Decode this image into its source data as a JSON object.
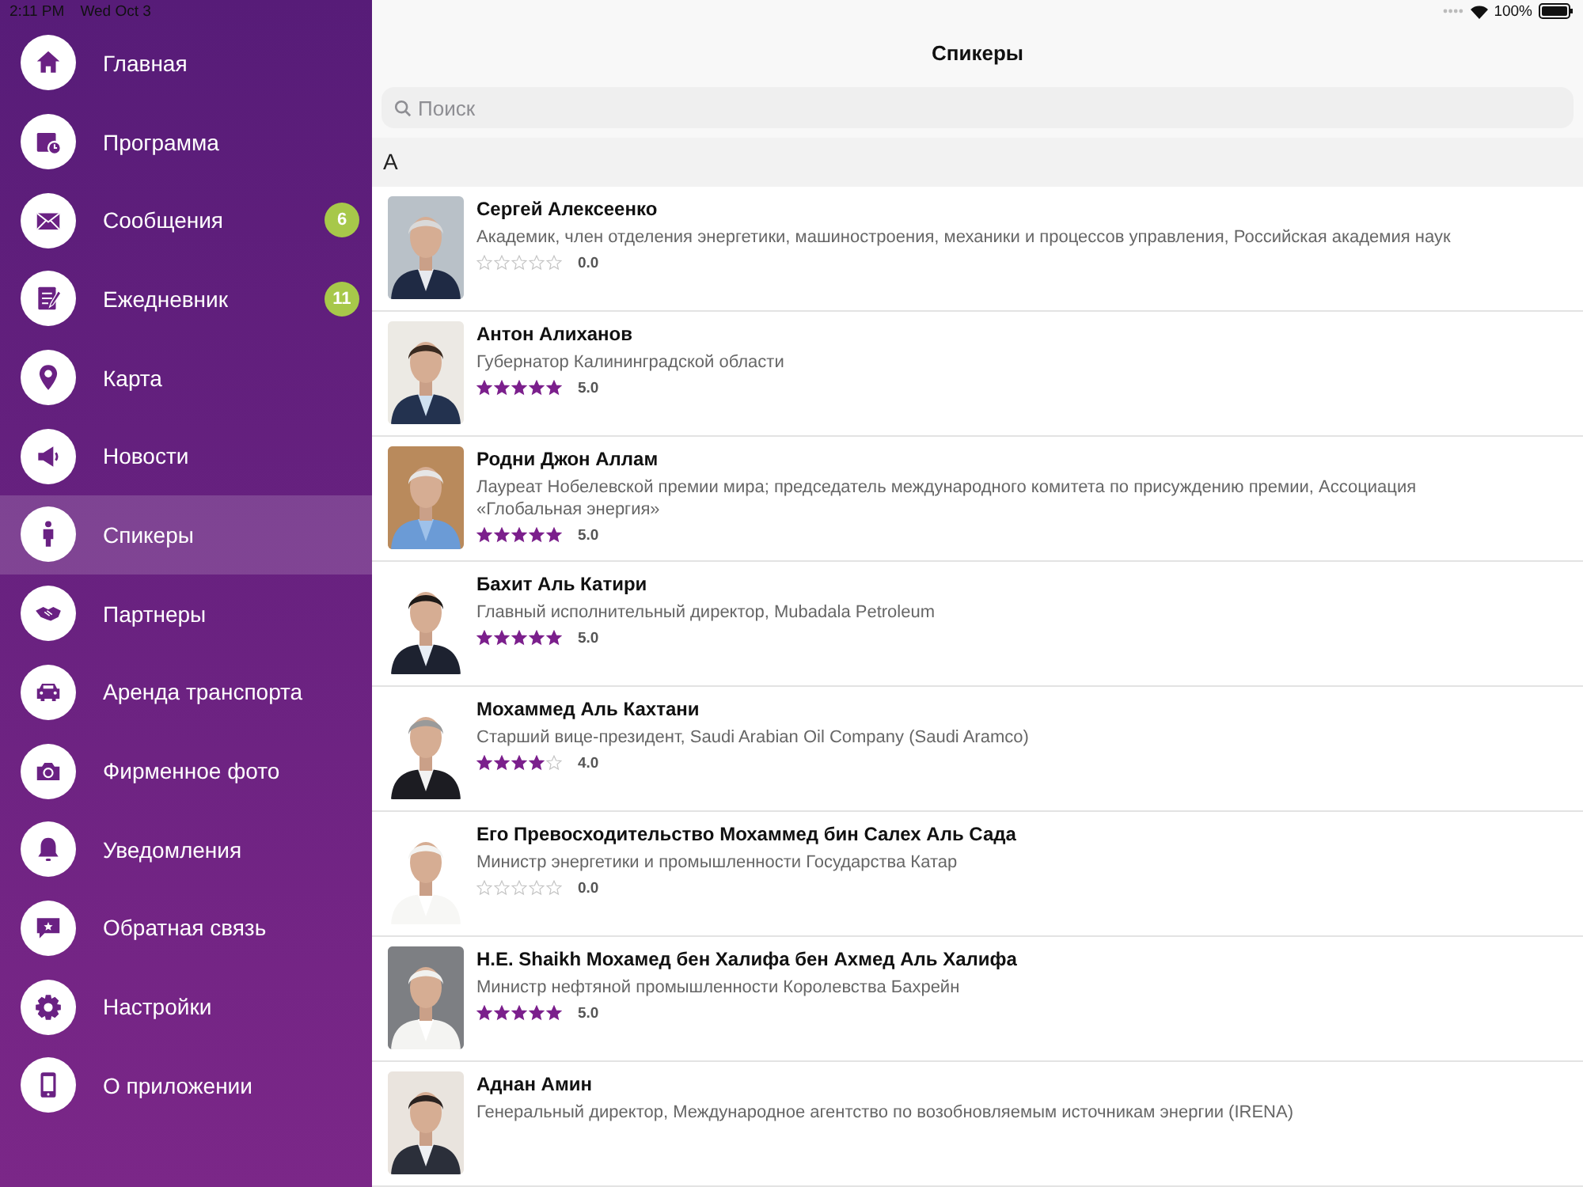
{
  "status_bar": {
    "time": "2:11 PM",
    "date": "Wed Oct 3",
    "battery": "100%"
  },
  "sidebar": {
    "items": [
      {
        "label": "Главная",
        "selected": false
      },
      {
        "label": "Программа",
        "selected": false
      },
      {
        "label": "Сообщения",
        "selected": false,
        "badge": "6"
      },
      {
        "label": "Ежедневник",
        "selected": false,
        "badge": "11"
      },
      {
        "label": "Карта",
        "selected": false
      },
      {
        "label": "Новости",
        "selected": false
      },
      {
        "label": "Спикеры",
        "selected": true
      },
      {
        "label": "Партнеры",
        "selected": false
      },
      {
        "label": "Аренда транспорта",
        "selected": false
      },
      {
        "label": "Фирменное фото",
        "selected": false
      },
      {
        "label": "Уведомления",
        "selected": false
      },
      {
        "label": "Обратная связь",
        "selected": false
      },
      {
        "label": "Настройки",
        "selected": false
      },
      {
        "label": "О приложении",
        "selected": false
      }
    ]
  },
  "title": "Спикеры",
  "search": {
    "placeholder": "Поиск"
  },
  "section": "А",
  "speakers": [
    {
      "name": "Сергей Алексеенко",
      "description": "Академик, член отделения энергетики, машиностроения, механики и процессов управления, Российская академия наук",
      "stars": 0,
      "rating": "0.0"
    },
    {
      "name": "Антон Алиханов",
      "description": "Губернатор Калининградской области",
      "stars": 5,
      "rating": "5.0"
    },
    {
      "name": "Родни Джон Аллам",
      "description": "Лауреат Нобелевской премии мира; председатель международного комитета по присуждению премии, Ассоциация «Глобальная энергия»",
      "stars": 5,
      "rating": "5.0"
    },
    {
      "name": "Бахит Аль Катири",
      "description": "Главный исполнительный директор, Mubadala Petroleum",
      "stars": 5,
      "rating": "5.0"
    },
    {
      "name": "Мохаммед Аль Кахтани",
      "description": "Старший вице-президент, Saudi Arabian Oil Company (Saudi Aramco)",
      "stars": 4,
      "rating": "4.0"
    },
    {
      "name": "Его Превосходительство Мохаммед бин Салех Аль Сада",
      "description": "Министр энергетики и промышленности Государства Катар",
      "stars": 0,
      "rating": "0.0"
    },
    {
      "name": "H.E. Shaikh Мохамед бен Халифа бен Ахмед Аль Халифа",
      "description": "Министр нефтяной промышленности Королевства Бахрейн",
      "stars": 5,
      "rating": "5.0"
    },
    {
      "name": "Аднан Амин",
      "description": "Генеральный директор, Международное агентство по возобновляемым источникам энергии (IRENA)"
    }
  ]
}
